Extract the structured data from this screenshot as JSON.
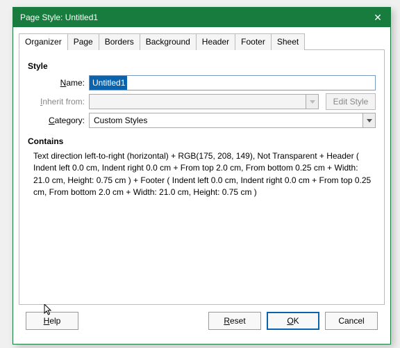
{
  "titlebar": {
    "title": "Page Style: Untitled1"
  },
  "tabs": [
    {
      "label": "Organizer",
      "active": true
    },
    {
      "label": "Page"
    },
    {
      "label": "Borders"
    },
    {
      "label": "Background"
    },
    {
      "label": "Header"
    },
    {
      "label": "Footer"
    },
    {
      "label": "Sheet"
    }
  ],
  "style": {
    "heading": "Style",
    "name_label_u": "N",
    "name_label_rest": "ame:",
    "name_value": "Untitled1",
    "inherit_label_u": "I",
    "inherit_label_rest": "nherit from:",
    "inherit_value": "",
    "edit_style_label": "Edit Style",
    "category_label_u": "C",
    "category_label_rest": "ategory:",
    "category_value": "Custom Styles"
  },
  "contains": {
    "heading": "Contains",
    "text": "Text direction left-to-right (horizontal) + RGB(175, 208, 149), Not Transparent + Header ( Indent left 0.0 cm, Indent right 0.0 cm + From top 2.0 cm, From bottom 0.25 cm + Width: 21.0 cm, Height: 0.75 cm )  + Footer ( Indent left 0.0 cm, Indent right 0.0 cm + From top 0.25 cm, From bottom 2.0 cm + Width: 21.0 cm, Height: 0.75 cm )"
  },
  "buttons": {
    "help_u": "H",
    "help_rest": "elp",
    "reset_u": "R",
    "reset_rest": "eset",
    "ok_u": "O",
    "ok_rest": "K",
    "cancel": "Cancel"
  }
}
